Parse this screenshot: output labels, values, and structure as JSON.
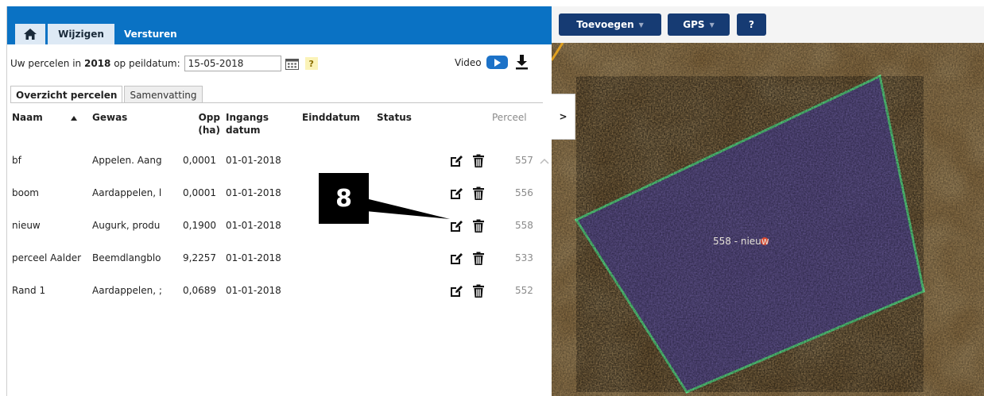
{
  "tabs": {
    "wijzigen": "Wijzigen",
    "versturen": "Versturen"
  },
  "dateline": {
    "prefix": "Uw percelen in",
    "year": "2018",
    "suffix": "op peildatum:",
    "date_value": "15-05-2018",
    "help": "?"
  },
  "video": {
    "label": "Video"
  },
  "subtabs": {
    "overzicht": "Overzicht percelen",
    "samenvatting": "Samenvatting"
  },
  "table": {
    "headers": {
      "naam": "Naam",
      "gewas": "Gewas",
      "opp_1": "Opp",
      "opp_2": "(ha)",
      "ingang_1": "Ingangs",
      "ingang_2": "datum",
      "einddatum": "Einddatum",
      "status": "Status",
      "perceel": "Perceel"
    },
    "rows": [
      {
        "naam": "bf",
        "gewas": "Appelen. Aang",
        "opp": "0,0001",
        "ingang": "01-01-2018",
        "perceel": "557"
      },
      {
        "naam": "boom",
        "gewas": "Aardappelen, l",
        "opp": "0,0001",
        "ingang": "01-01-2018",
        "perceel": "556"
      },
      {
        "naam": "nieuw",
        "gewas": "Augurk, produ",
        "opp": "0,1900",
        "ingang": "01-01-2018",
        "perceel": "558"
      },
      {
        "naam": "perceel Aalder",
        "gewas": "Beemdlangblo",
        "opp": "9,2257",
        "ingang": "01-01-2018",
        "perceel": "533"
      },
      {
        "naam": "Rand 1",
        "gewas": "Aardappelen, ;",
        "opp": "0,0689",
        "ingang": "01-01-2018",
        "perceel": "552"
      }
    ]
  },
  "map_toolbar": {
    "toevoegen": "Toevoegen",
    "gps": "GPS",
    "help": "?"
  },
  "collapse_label": ">",
  "map_label": "558  - nieuw",
  "callout": "8",
  "colors": {
    "topbar": "#0a72c4",
    "map_button": "#163b73",
    "parcel_fill": "#5a4fa0",
    "parcel_border": "#5ee08a"
  }
}
